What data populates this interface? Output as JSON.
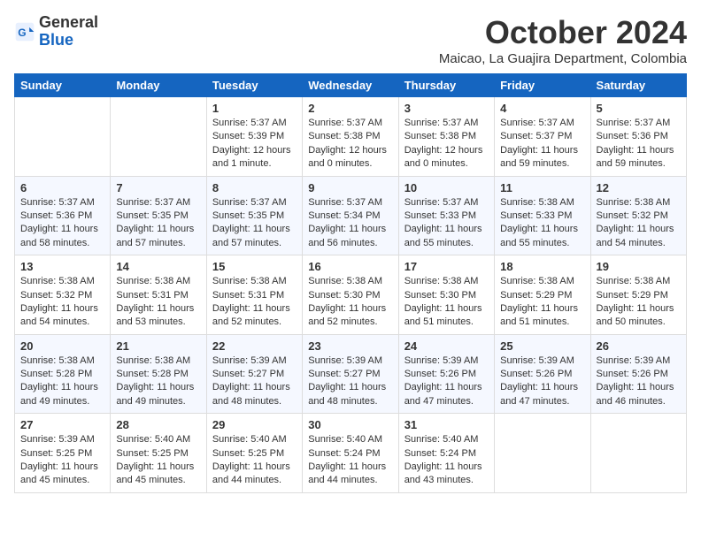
{
  "header": {
    "logo": {
      "general": "General",
      "blue": "Blue"
    },
    "month": "October 2024",
    "location": "Maicao, La Guajira Department, Colombia"
  },
  "days_of_week": [
    "Sunday",
    "Monday",
    "Tuesday",
    "Wednesday",
    "Thursday",
    "Friday",
    "Saturday"
  ],
  "weeks": [
    [
      {
        "day": "",
        "content": ""
      },
      {
        "day": "",
        "content": ""
      },
      {
        "day": "1",
        "content": "Sunrise: 5:37 AM\nSunset: 5:39 PM\nDaylight: 12 hours and 1 minute."
      },
      {
        "day": "2",
        "content": "Sunrise: 5:37 AM\nSunset: 5:38 PM\nDaylight: 12 hours and 0 minutes."
      },
      {
        "day": "3",
        "content": "Sunrise: 5:37 AM\nSunset: 5:38 PM\nDaylight: 12 hours and 0 minutes."
      },
      {
        "day": "4",
        "content": "Sunrise: 5:37 AM\nSunset: 5:37 PM\nDaylight: 11 hours and 59 minutes."
      },
      {
        "day": "5",
        "content": "Sunrise: 5:37 AM\nSunset: 5:36 PM\nDaylight: 11 hours and 59 minutes."
      }
    ],
    [
      {
        "day": "6",
        "content": "Sunrise: 5:37 AM\nSunset: 5:36 PM\nDaylight: 11 hours and 58 minutes."
      },
      {
        "day": "7",
        "content": "Sunrise: 5:37 AM\nSunset: 5:35 PM\nDaylight: 11 hours and 57 minutes."
      },
      {
        "day": "8",
        "content": "Sunrise: 5:37 AM\nSunset: 5:35 PM\nDaylight: 11 hours and 57 minutes."
      },
      {
        "day": "9",
        "content": "Sunrise: 5:37 AM\nSunset: 5:34 PM\nDaylight: 11 hours and 56 minutes."
      },
      {
        "day": "10",
        "content": "Sunrise: 5:37 AM\nSunset: 5:33 PM\nDaylight: 11 hours and 55 minutes."
      },
      {
        "day": "11",
        "content": "Sunrise: 5:38 AM\nSunset: 5:33 PM\nDaylight: 11 hours and 55 minutes."
      },
      {
        "day": "12",
        "content": "Sunrise: 5:38 AM\nSunset: 5:32 PM\nDaylight: 11 hours and 54 minutes."
      }
    ],
    [
      {
        "day": "13",
        "content": "Sunrise: 5:38 AM\nSunset: 5:32 PM\nDaylight: 11 hours and 54 minutes."
      },
      {
        "day": "14",
        "content": "Sunrise: 5:38 AM\nSunset: 5:31 PM\nDaylight: 11 hours and 53 minutes."
      },
      {
        "day": "15",
        "content": "Sunrise: 5:38 AM\nSunset: 5:31 PM\nDaylight: 11 hours and 52 minutes."
      },
      {
        "day": "16",
        "content": "Sunrise: 5:38 AM\nSunset: 5:30 PM\nDaylight: 11 hours and 52 minutes."
      },
      {
        "day": "17",
        "content": "Sunrise: 5:38 AM\nSunset: 5:30 PM\nDaylight: 11 hours and 51 minutes."
      },
      {
        "day": "18",
        "content": "Sunrise: 5:38 AM\nSunset: 5:29 PM\nDaylight: 11 hours and 51 minutes."
      },
      {
        "day": "19",
        "content": "Sunrise: 5:38 AM\nSunset: 5:29 PM\nDaylight: 11 hours and 50 minutes."
      }
    ],
    [
      {
        "day": "20",
        "content": "Sunrise: 5:38 AM\nSunset: 5:28 PM\nDaylight: 11 hours and 49 minutes."
      },
      {
        "day": "21",
        "content": "Sunrise: 5:38 AM\nSunset: 5:28 PM\nDaylight: 11 hours and 49 minutes."
      },
      {
        "day": "22",
        "content": "Sunrise: 5:39 AM\nSunset: 5:27 PM\nDaylight: 11 hours and 48 minutes."
      },
      {
        "day": "23",
        "content": "Sunrise: 5:39 AM\nSunset: 5:27 PM\nDaylight: 11 hours and 48 minutes."
      },
      {
        "day": "24",
        "content": "Sunrise: 5:39 AM\nSunset: 5:26 PM\nDaylight: 11 hours and 47 minutes."
      },
      {
        "day": "25",
        "content": "Sunrise: 5:39 AM\nSunset: 5:26 PM\nDaylight: 11 hours and 47 minutes."
      },
      {
        "day": "26",
        "content": "Sunrise: 5:39 AM\nSunset: 5:26 PM\nDaylight: 11 hours and 46 minutes."
      }
    ],
    [
      {
        "day": "27",
        "content": "Sunrise: 5:39 AM\nSunset: 5:25 PM\nDaylight: 11 hours and 45 minutes."
      },
      {
        "day": "28",
        "content": "Sunrise: 5:40 AM\nSunset: 5:25 PM\nDaylight: 11 hours and 45 minutes."
      },
      {
        "day": "29",
        "content": "Sunrise: 5:40 AM\nSunset: 5:25 PM\nDaylight: 11 hours and 44 minutes."
      },
      {
        "day": "30",
        "content": "Sunrise: 5:40 AM\nSunset: 5:24 PM\nDaylight: 11 hours and 44 minutes."
      },
      {
        "day": "31",
        "content": "Sunrise: 5:40 AM\nSunset: 5:24 PM\nDaylight: 11 hours and 43 minutes."
      },
      {
        "day": "",
        "content": ""
      },
      {
        "day": "",
        "content": ""
      }
    ]
  ]
}
